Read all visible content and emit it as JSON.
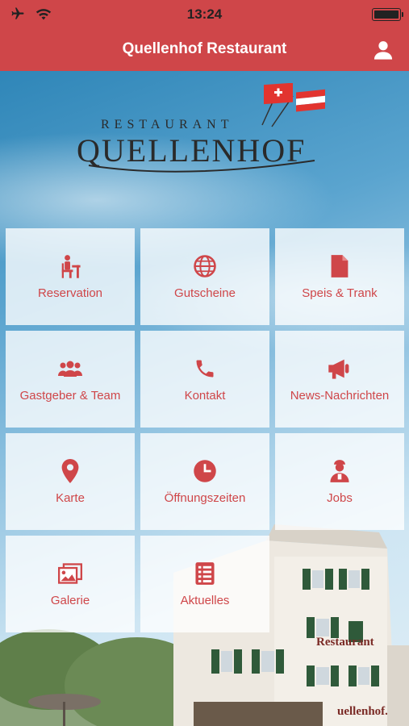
{
  "status_bar": {
    "time": "13:24"
  },
  "nav": {
    "title": "Quellenhof Restaurant"
  },
  "logo": {
    "top_text": "RESTAURANT",
    "main_text": "QUELLENHOF"
  },
  "building": {
    "sign_1": "Restaurant",
    "sign_2": "uellenhof."
  },
  "accent": "#cf4649",
  "menu": [
    {
      "label": "Reservation",
      "icon": "reservation-icon"
    },
    {
      "label": "Gutscheine",
      "icon": "globe-icon"
    },
    {
      "label": "Speis & Trank",
      "icon": "document-icon"
    },
    {
      "label": "Gastgeber & Team",
      "icon": "group-icon"
    },
    {
      "label": "Kontakt",
      "icon": "phone-icon"
    },
    {
      "label": "News-Nachrichten",
      "icon": "megaphone-icon"
    },
    {
      "label": "Karte",
      "icon": "map-pin-icon"
    },
    {
      "label": "Öffnungszeiten",
      "icon": "clock-icon"
    },
    {
      "label": "Jobs",
      "icon": "person-icon"
    },
    {
      "label": "Galerie",
      "icon": "photos-icon"
    },
    {
      "label": "Aktuelles",
      "icon": "list-icon"
    }
  ]
}
